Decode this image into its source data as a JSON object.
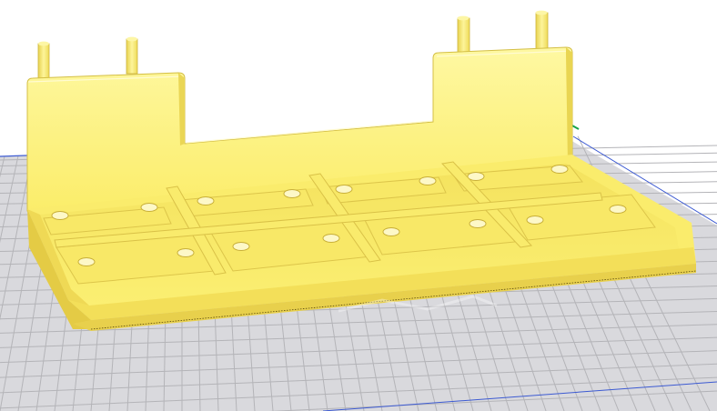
{
  "app": {
    "view": "3d-viewport",
    "object": "yellow-tray-with-pegs"
  },
  "colors": {
    "background": "#ffffff",
    "build_plate_fill": "#d8d8dc",
    "grid_line": "#b8b8bc",
    "plate_edge_blue": "#3c5ad2",
    "axis_green": "#16a34a",
    "model_main": "#fdf37a",
    "model_light": "#fef9a8",
    "model_mid": "#f6e561",
    "model_shadow": "#e5cc47",
    "model_dark": "#cbb13a"
  }
}
